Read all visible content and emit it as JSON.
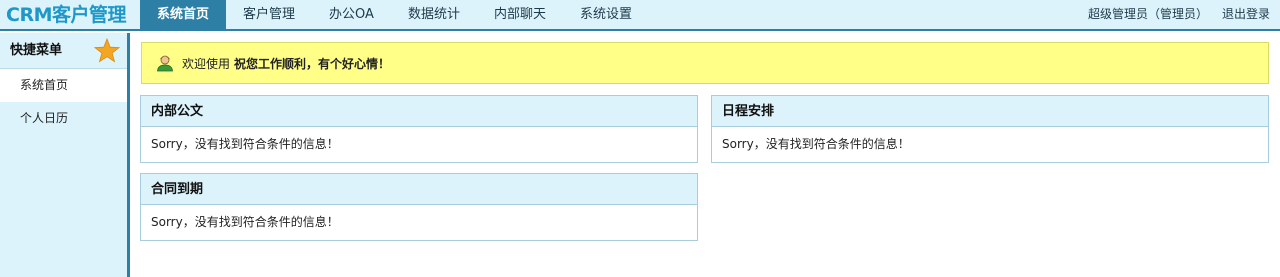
{
  "header": {
    "logo": "CRM客户管理",
    "nav": [
      {
        "label": "系统首页",
        "active": true
      },
      {
        "label": "客户管理",
        "active": false
      },
      {
        "label": "办公OA",
        "active": false
      },
      {
        "label": "数据统计",
        "active": false
      },
      {
        "label": "内部聊天",
        "active": false
      },
      {
        "label": "系统设置",
        "active": false
      }
    ],
    "user": "超级管理员（管理员）",
    "logout": "退出登录"
  },
  "sidebar": {
    "title": "快捷菜单",
    "items": [
      {
        "label": "系统首页",
        "active": true
      },
      {
        "label": "个人日历",
        "active": false
      }
    ]
  },
  "welcome": {
    "prefix": "欢迎使用",
    "message": "祝您工作顺利，有个好心情！"
  },
  "panels": {
    "notices": {
      "title": "内部公文",
      "empty": "Sorry，没有找到符合条件的信息！"
    },
    "schedule": {
      "title": "日程安排",
      "empty": "Sorry，没有找到符合条件的信息！"
    },
    "contracts": {
      "title": "合同到期",
      "empty": "Sorry，没有找到符合条件的信息！"
    }
  },
  "colors": {
    "accent": "#2d7fa6",
    "header_bg": "#ddf3fb",
    "logo": "#1e97c9",
    "banner_bg": "#ffff88",
    "star": "#f4a623"
  },
  "icons": {
    "star": "star-icon",
    "user": "user-icon"
  }
}
